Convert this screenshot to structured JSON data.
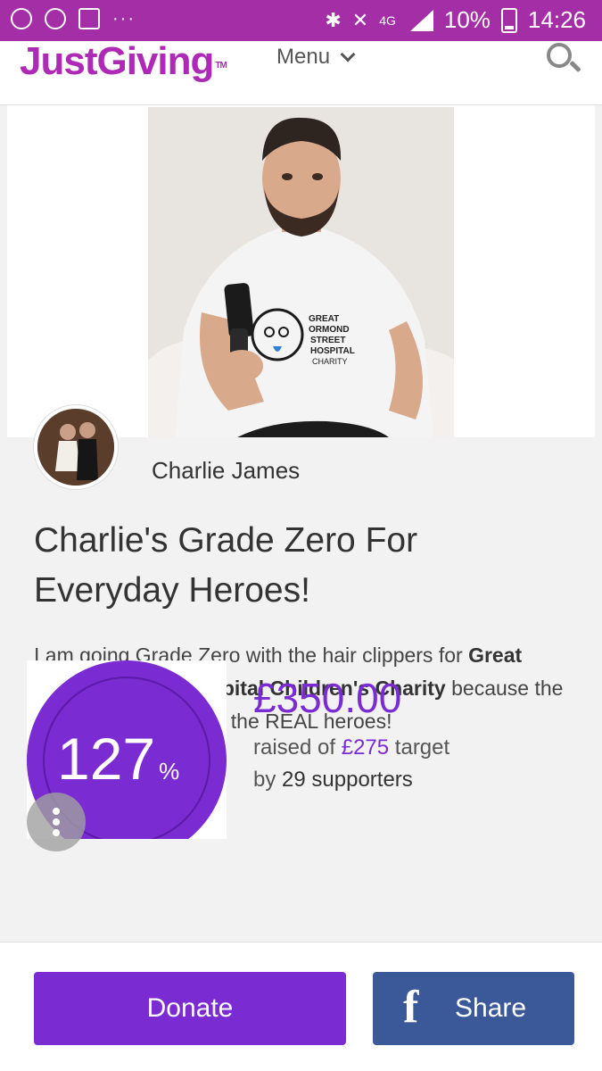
{
  "status_bar": {
    "notifications": "···",
    "network": "4G",
    "battery": "10%",
    "time": "14:26"
  },
  "header": {
    "logo": "JustGiving",
    "logo_tm": "TM",
    "menu_label": "Menu"
  },
  "page": {
    "owner_name": "Charlie James",
    "title": "Charlie's Grade Zero For Everyday Heroes!",
    "description_pre": "I am going Grade Zero with the hair clippers for",
    "charity": "Great Ormond Street Hospital Children's Charity",
    "description_post": "because the staff and patients are the REAL heroes!",
    "progress": {
      "percent": "127",
      "percent_sign": "%"
    },
    "raised": "£350.00",
    "raised_of": "raised of",
    "target": "£275",
    "target_label": "target",
    "by": "by",
    "supporters": "29 supporters",
    "shirt_text": [
      "GREAT",
      "ORMOND",
      "STREET",
      "HOSPITAL",
      "CHARITY"
    ]
  },
  "actions": {
    "donate_label": "Donate",
    "share_label": "Share",
    "facebook_glyph": "f"
  },
  "colors": {
    "brand": "#ad29b6",
    "accent": "#7b2bd2",
    "facebook": "#3b5998",
    "statusbar": "#a32ea5"
  }
}
